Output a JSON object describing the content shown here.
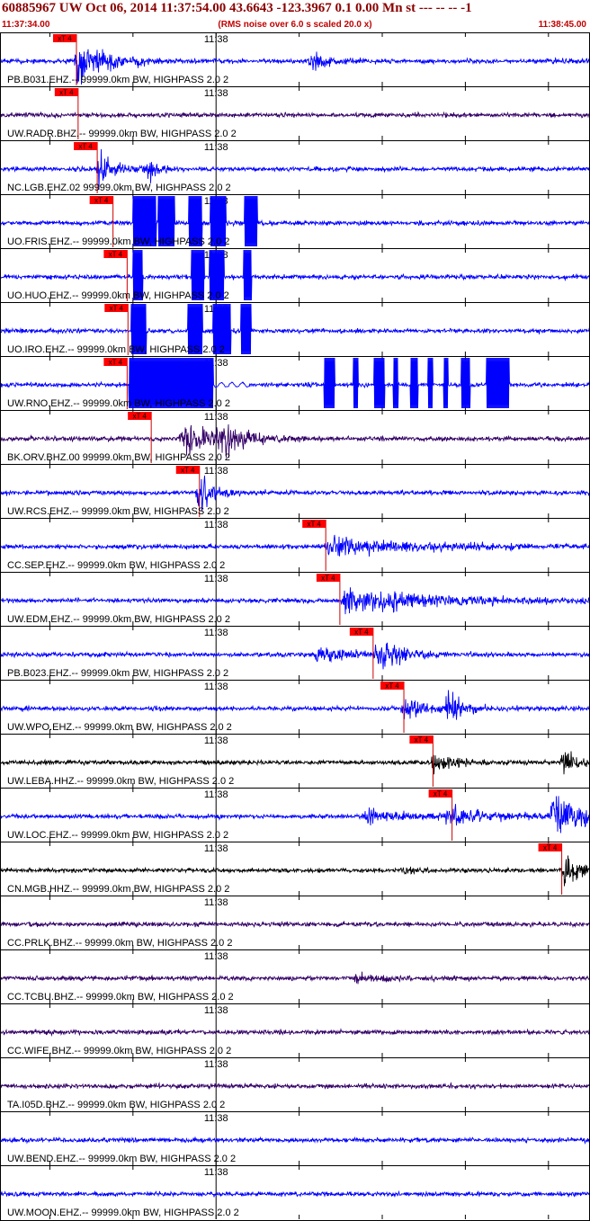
{
  "header": {
    "title": "60885967 UW Oct 06, 2014 11:37:54.00   43.6643 -123.3967  0.1 0.00 Mn st --- -- --  -1",
    "start_time": "11:37:34.00",
    "end_time": "11:38:45.00",
    "subtitle": "(RMS noise over 6.0 s scaled 20.0 x)"
  },
  "time_axis": {
    "start_seconds": 34.0,
    "end_seconds": 105.0,
    "minute_tick_label": "11:38",
    "minute_tick_seconds": 60.0
  },
  "colors": {
    "blue": "#0000ff",
    "purple": "#330066",
    "black": "#000000",
    "pick_box": "#ff0000",
    "pick_line": "#cc0000",
    "header_title": "#8b0000",
    "header_red": "#c00000"
  },
  "pick_label": "xT 4",
  "traces": [
    {
      "label": "PB.B031.EHZ.-- 99999.0km BW, HIGHPASS  2.0  2",
      "color": "blue",
      "pick": 43.2,
      "events": [
        [
          43.4,
          3.5,
          8
        ],
        [
          71.5,
          2.0,
          3
        ]
      ]
    },
    {
      "label": "UW.RADR.BHZ.-- 99999.0km BW, HIGHPASS  2.0  2",
      "color": "purple",
      "pick": 43.4,
      "events": []
    },
    {
      "label": "NC.LGB.EHZ.02 99999.0km BW, HIGHPASS  2.0  2",
      "color": "blue",
      "pick": 45.7,
      "events": [
        [
          46.0,
          2.0,
          6
        ],
        [
          51.9,
          1.0,
          4
        ]
      ]
    },
    {
      "label": "UO.FRIS.EHZ.-- 99999.0km BW, HIGHPASS  2.0  2",
      "color": "blue",
      "pick": 47.6,
      "bursts": [
        [
          50.0,
          52.8
        ],
        [
          53.0,
          55.0
        ],
        [
          56.7,
          58.3
        ],
        [
          59.3,
          61.2
        ],
        [
          63.4,
          65.0
        ]
      ],
      "events": []
    },
    {
      "label": "UO.HUO.EHZ.-- 99999.0km BW, HIGHPASS  2.0  2",
      "color": "blue",
      "pick": 49.3,
      "bursts": [
        [
          50.0,
          51.2
        ],
        [
          57.0,
          58.6
        ],
        [
          59.2,
          61.0
        ],
        [
          63.3,
          64.3
        ]
      ],
      "events": []
    },
    {
      "label": "UO.IRO.EHZ.-- 99999.0km BW, HIGHPASS  2.0  2",
      "color": "blue",
      "pick": 49.4,
      "bursts": [
        [
          49.8,
          51.6
        ],
        [
          56.6,
          58.4
        ],
        [
          59.6,
          61.8
        ],
        [
          63.0,
          64.2
        ]
      ],
      "events": []
    },
    {
      "label": "UW.RNO.EHZ.-- 99999.0km BW, HIGHPASS  2.0  2",
      "color": "blue",
      "pick": 49.3,
      "bursts": [
        [
          49.5,
          59.7
        ],
        [
          73.0,
          74.3
        ],
        [
          76.5,
          77.1
        ],
        [
          79.0,
          80.3
        ],
        [
          81.3,
          81.9
        ],
        [
          83.4,
          84.3
        ],
        [
          85.5,
          86.1
        ],
        [
          87.4,
          87.9
        ],
        [
          89.5,
          90.6
        ],
        [
          92.5,
          95.3
        ]
      ],
      "wavy": [
        59.7,
        64.0
      ],
      "events": []
    },
    {
      "label": "BK.ORV.BHZ.00 99999.0km BW, HIGHPASS  2.0  2",
      "color": "purple",
      "pick": 52.2,
      "events": [
        [
          56.0,
          3.0,
          6
        ],
        [
          60.5,
          3.0,
          5
        ]
      ]
    },
    {
      "label": "UW.RCS.EHZ.-- 99999.0km BW, HIGHPASS  2.0  2",
      "color": "blue",
      "pick": 58.0,
      "events": [
        [
          58.0,
          1.5,
          6
        ]
      ]
    },
    {
      "label": "CC.SEP.EHZ.-- 99999.0km BW, HIGHPASS  2.0  2",
      "color": "blue",
      "pick": 73.2,
      "events": [
        [
          73.5,
          10.0,
          3
        ]
      ]
    },
    {
      "label": "UW.EDM.EHZ.-- 99999.0km BW, HIGHPASS  2.0  2",
      "color": "blue",
      "pick": 74.9,
      "events": [
        [
          75.5,
          11.0,
          4
        ]
      ]
    },
    {
      "label": "PB.B023.EHZ.-- 99999.0km BW, HIGHPASS  2.0  2",
      "color": "blue",
      "pick": 78.9,
      "events": [
        [
          72.0,
          4.0,
          2.5
        ],
        [
          79.5,
          2.5,
          6
        ]
      ]
    },
    {
      "label": "UW.WPO.EHZ.-- 99999.0km BW, HIGHPASS  2.0  2",
      "color": "blue",
      "pick": 82.6,
      "events": [
        [
          82.7,
          3.0,
          4
        ],
        [
          88.0,
          1.5,
          5
        ]
      ]
    },
    {
      "label": "UW.LEBA.HHZ.-- 99999.0km BW, HIGHPASS  2.0  2",
      "color": "black",
      "pick": 86.1,
      "events": [
        [
          86.2,
          2.0,
          4
        ],
        [
          101.8,
          2.0,
          4
        ]
      ]
    },
    {
      "label": "UW.LOC.EHZ.-- 99999.0km BW, HIGHPASS  2.0  2",
      "color": "blue",
      "pick": 88.4,
      "events": [
        [
          78.0,
          6.0,
          2
        ],
        [
          88.0,
          4.5,
          3
        ],
        [
          100.5,
          4.0,
          8
        ]
      ]
    },
    {
      "label": "CN.MGB.HHZ.-- 99999.0km BW, HIGHPASS  2.0  2",
      "color": "black",
      "pick": 101.6,
      "events": [
        [
          101.9,
          2.2,
          5
        ],
        [
          83.0,
          1.0,
          2
        ]
      ]
    },
    {
      "label": "CC.PRLK.BHZ.-- 99999.0km BW, HIGHPASS  2.0  2",
      "color": "purple",
      "pick": null,
      "events": []
    },
    {
      "label": "CC.TCBU.BHZ.-- 99999.0km BW, HIGHPASS  2.0  2",
      "color": "purple",
      "pick": null,
      "events": [
        [
          77.0,
          3.0,
          1.8
        ]
      ]
    },
    {
      "label": "CC.WIFE.BHZ.-- 99999.0km BW, HIGHPASS  2.0  2",
      "color": "purple",
      "pick": null,
      "events": []
    },
    {
      "label": "TA.I05D.BHZ.-- 99999.0km BW, HIGHPASS  2.0  2",
      "color": "purple",
      "pick": null,
      "events": []
    },
    {
      "label": "UW.BEND.EHZ.-- 99999.0km BW, HIGHPASS  2.0  2",
      "color": "blue",
      "pick": null,
      "events": []
    },
    {
      "label": "UW.MOON.EHZ.-- 99999.0km BW, HIGHPASS  2.0  2",
      "color": "blue",
      "pick": null,
      "events": []
    }
  ]
}
